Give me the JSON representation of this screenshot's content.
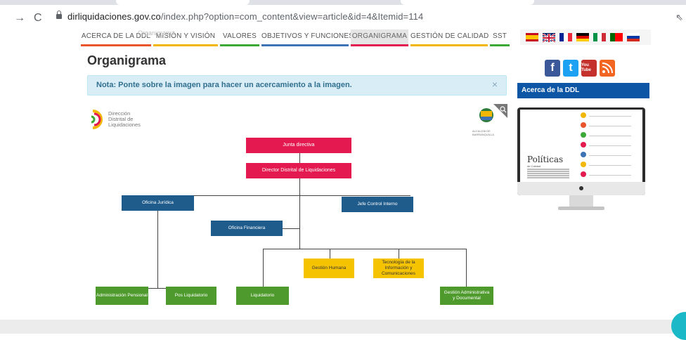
{
  "browser": {
    "back_label": "→",
    "reload_label": "C",
    "url_domain": "dirliquidaciones.gov.co",
    "url_path": "/index.php?option=com_content&view=article&id=4&Itemid=114",
    "ext_label": "⇖"
  },
  "nav": {
    "items": [
      {
        "label": "ACERCA DE LA DDL",
        "bar": "#e9542b"
      },
      {
        "label": "MISIÓN Y VISIÓN",
        "bar": "#f2b705"
      },
      {
        "label": "VALORES",
        "bar": "#3aa935"
      },
      {
        "label": "OBJETIVOS Y FUNCIONES",
        "bar": "#3d73b5"
      },
      {
        "label": "ORGANIGRAMA",
        "bar": "#e3194f"
      },
      {
        "label": "GESTIÓN DE CALIDAD",
        "bar": "#f2b705"
      },
      {
        "label": "SST",
        "bar": "#3aa935"
      }
    ],
    "ghost_label": "Organigrama"
  },
  "flags": [
    "es",
    "gb",
    "fr",
    "de",
    "it",
    "pt",
    "ru"
  ],
  "page": {
    "title": "Organigrama",
    "note": "Nota: Ponte sobre la imagen para hacer un acercamiento a la imagen.",
    "note_close": "×"
  },
  "org": {
    "logo_lines": [
      "Dirección",
      "Distrital de",
      "Liquidaciones"
    ],
    "alcaldia": "ALCALDÍA DE BARRANQUILLA",
    "junta": "Junta directiva",
    "director": "Director Distrital de Liquidaciones",
    "juridica": "Oficina Jurídica",
    "control": "Jefe Control Interno",
    "financiera": "Oficina Financiera",
    "gestion_humana": "Gestión Humana",
    "tecnologia": "Tecnología de la Información y Comunicaciones",
    "admin_pensional": "Administración Pensional",
    "pos_liquidatorio": "Pos Liquidatorio",
    "liquidatorio": "Liquidatorio",
    "gestion_admin": "Gestión Administrativa y Documental"
  },
  "side": {
    "social": [
      "f",
      "t",
      "You Tube",
      "rss"
    ],
    "heading": "Acerca de la DDL",
    "monitor_title": "Políticas",
    "monitor_sub": "de Calidad"
  }
}
